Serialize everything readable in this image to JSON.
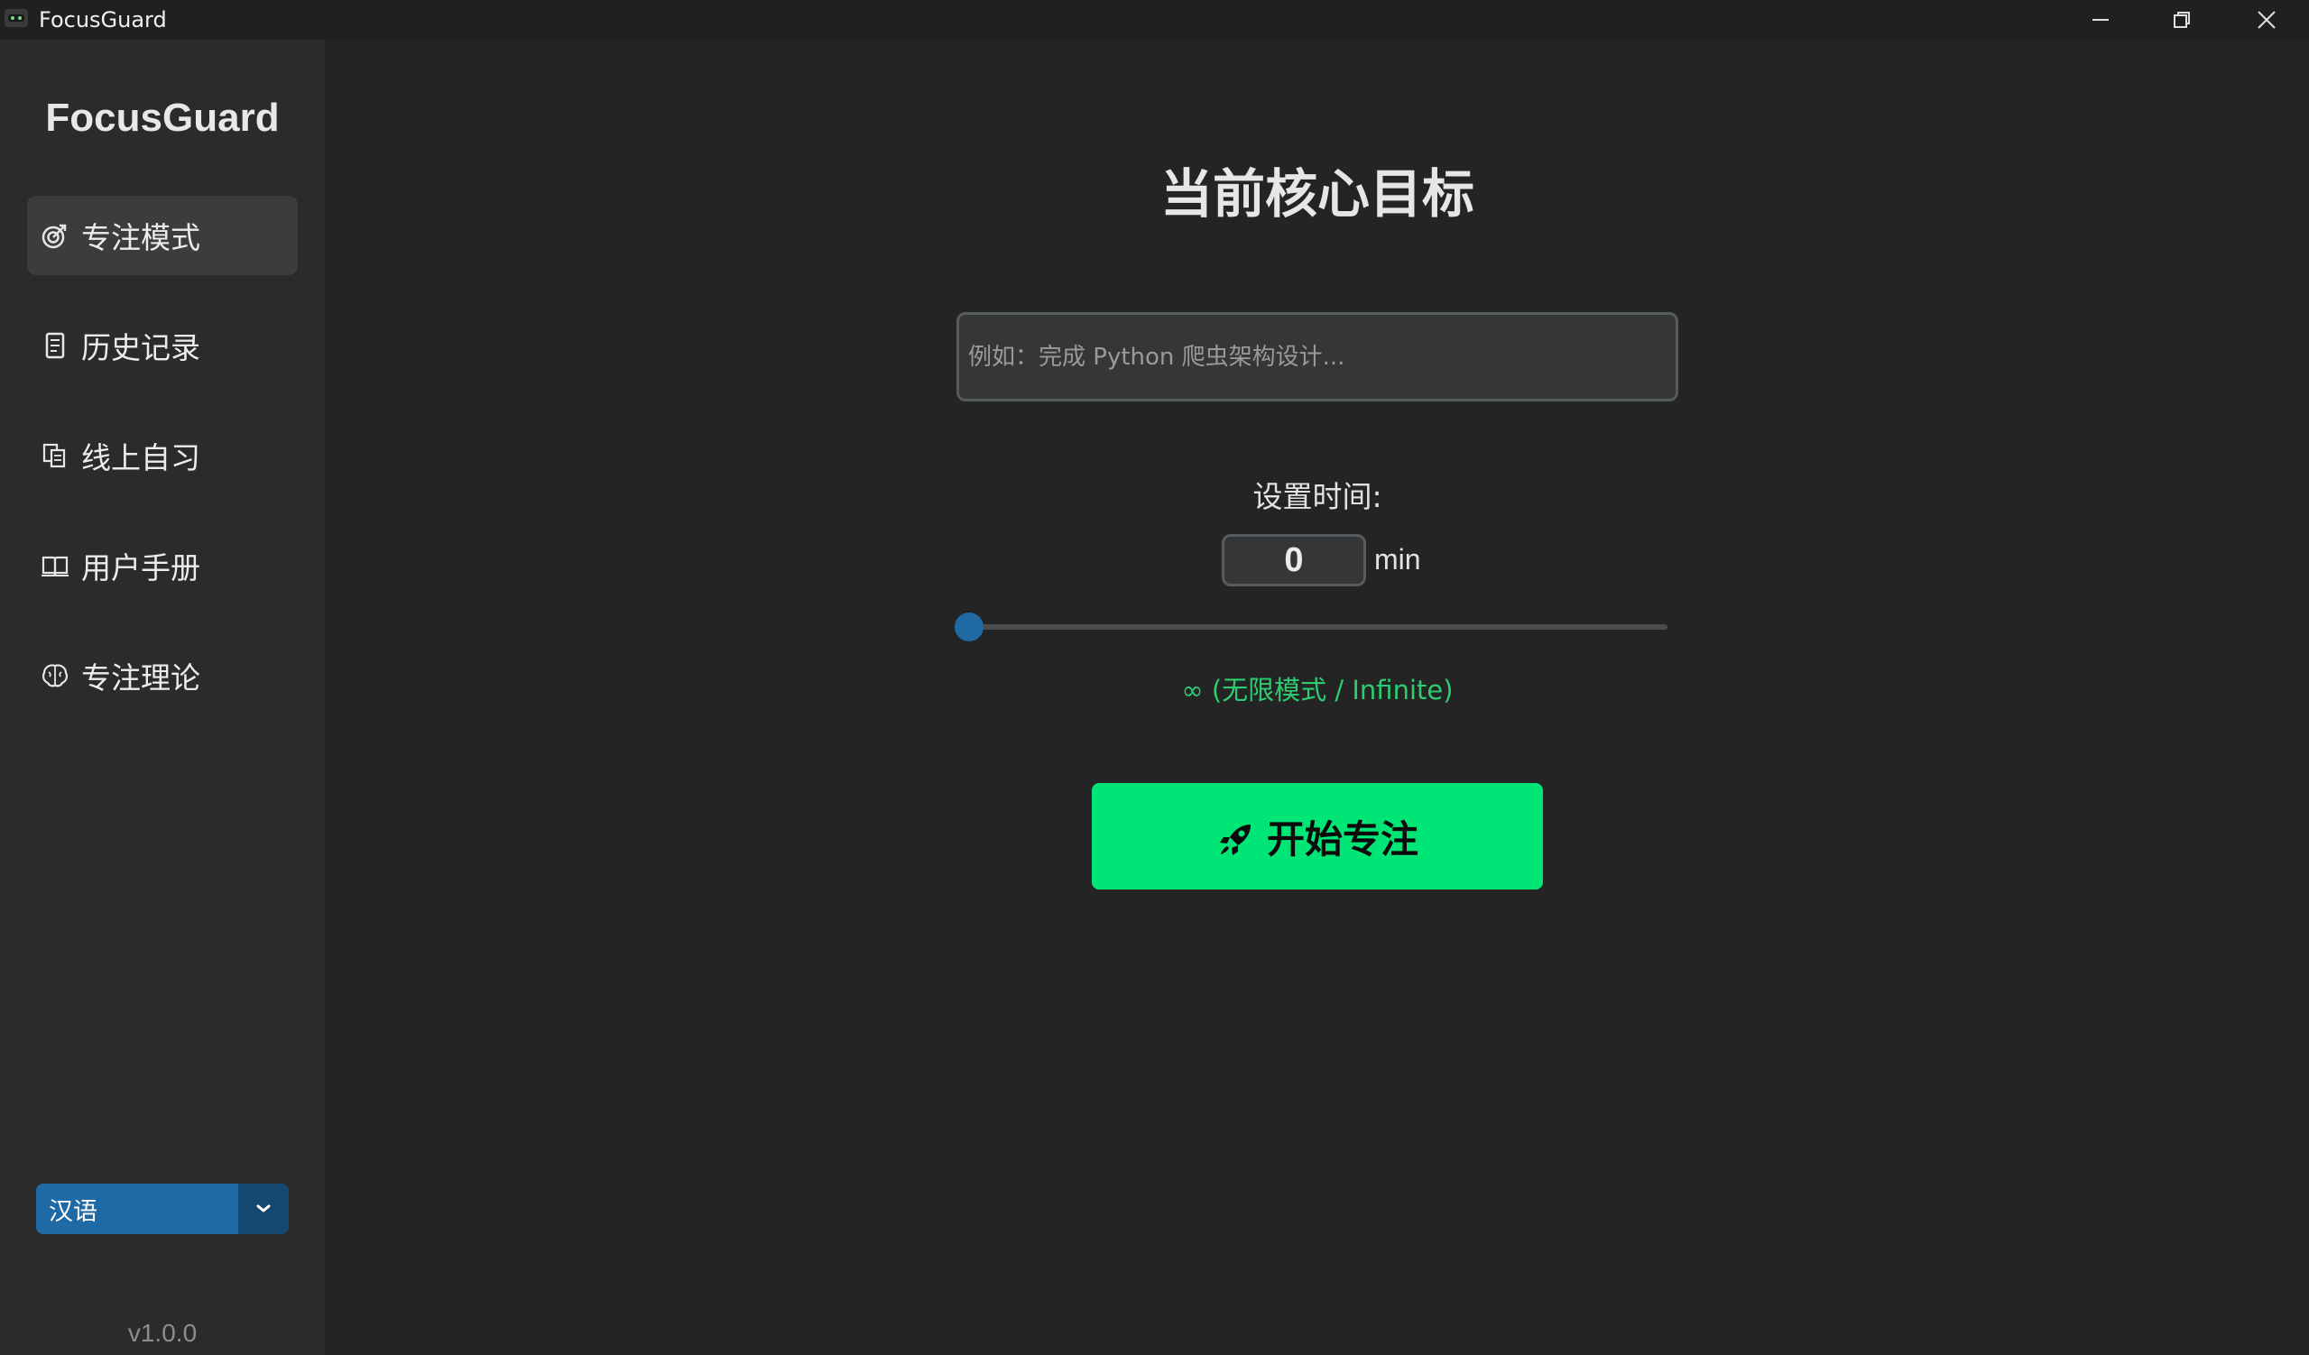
{
  "window": {
    "title": "FocusGuard",
    "app_icon": "app-logo-icon",
    "controls": [
      "minimize-icon",
      "restore-icon",
      "close-icon"
    ]
  },
  "sidebar": {
    "brand": "FocusGuard",
    "items": [
      {
        "label": "专注模式",
        "icon": "target-icon",
        "active": true
      },
      {
        "label": "历史记录",
        "icon": "scroll-icon",
        "active": false
      },
      {
        "label": "线上自习",
        "icon": "documents-icon",
        "active": false
      },
      {
        "label": "用户手册",
        "icon": "book-icon",
        "active": false
      },
      {
        "label": "专注理论",
        "icon": "brain-icon",
        "active": false
      }
    ],
    "language": {
      "selected": "汉语"
    },
    "version": "v1.0.0"
  },
  "main": {
    "heading": "当前核心目标",
    "goal_input": {
      "value": "",
      "placeholder": "例如：完成 Python 爬虫架构设计..."
    },
    "time_label": "设置时间:",
    "time_value": "0",
    "time_unit": "min",
    "slider_value": 0,
    "mode_label": "∞ (无限模式 / Infinite)",
    "start_button": {
      "label": "开始专注",
      "icon": "rocket-icon"
    }
  },
  "colors": {
    "accent": "#1f6aa5",
    "start_button": "#00e676",
    "mode_text": "#2ecc71",
    "background": "#242424",
    "sidebar": "#2b2b2b"
  }
}
